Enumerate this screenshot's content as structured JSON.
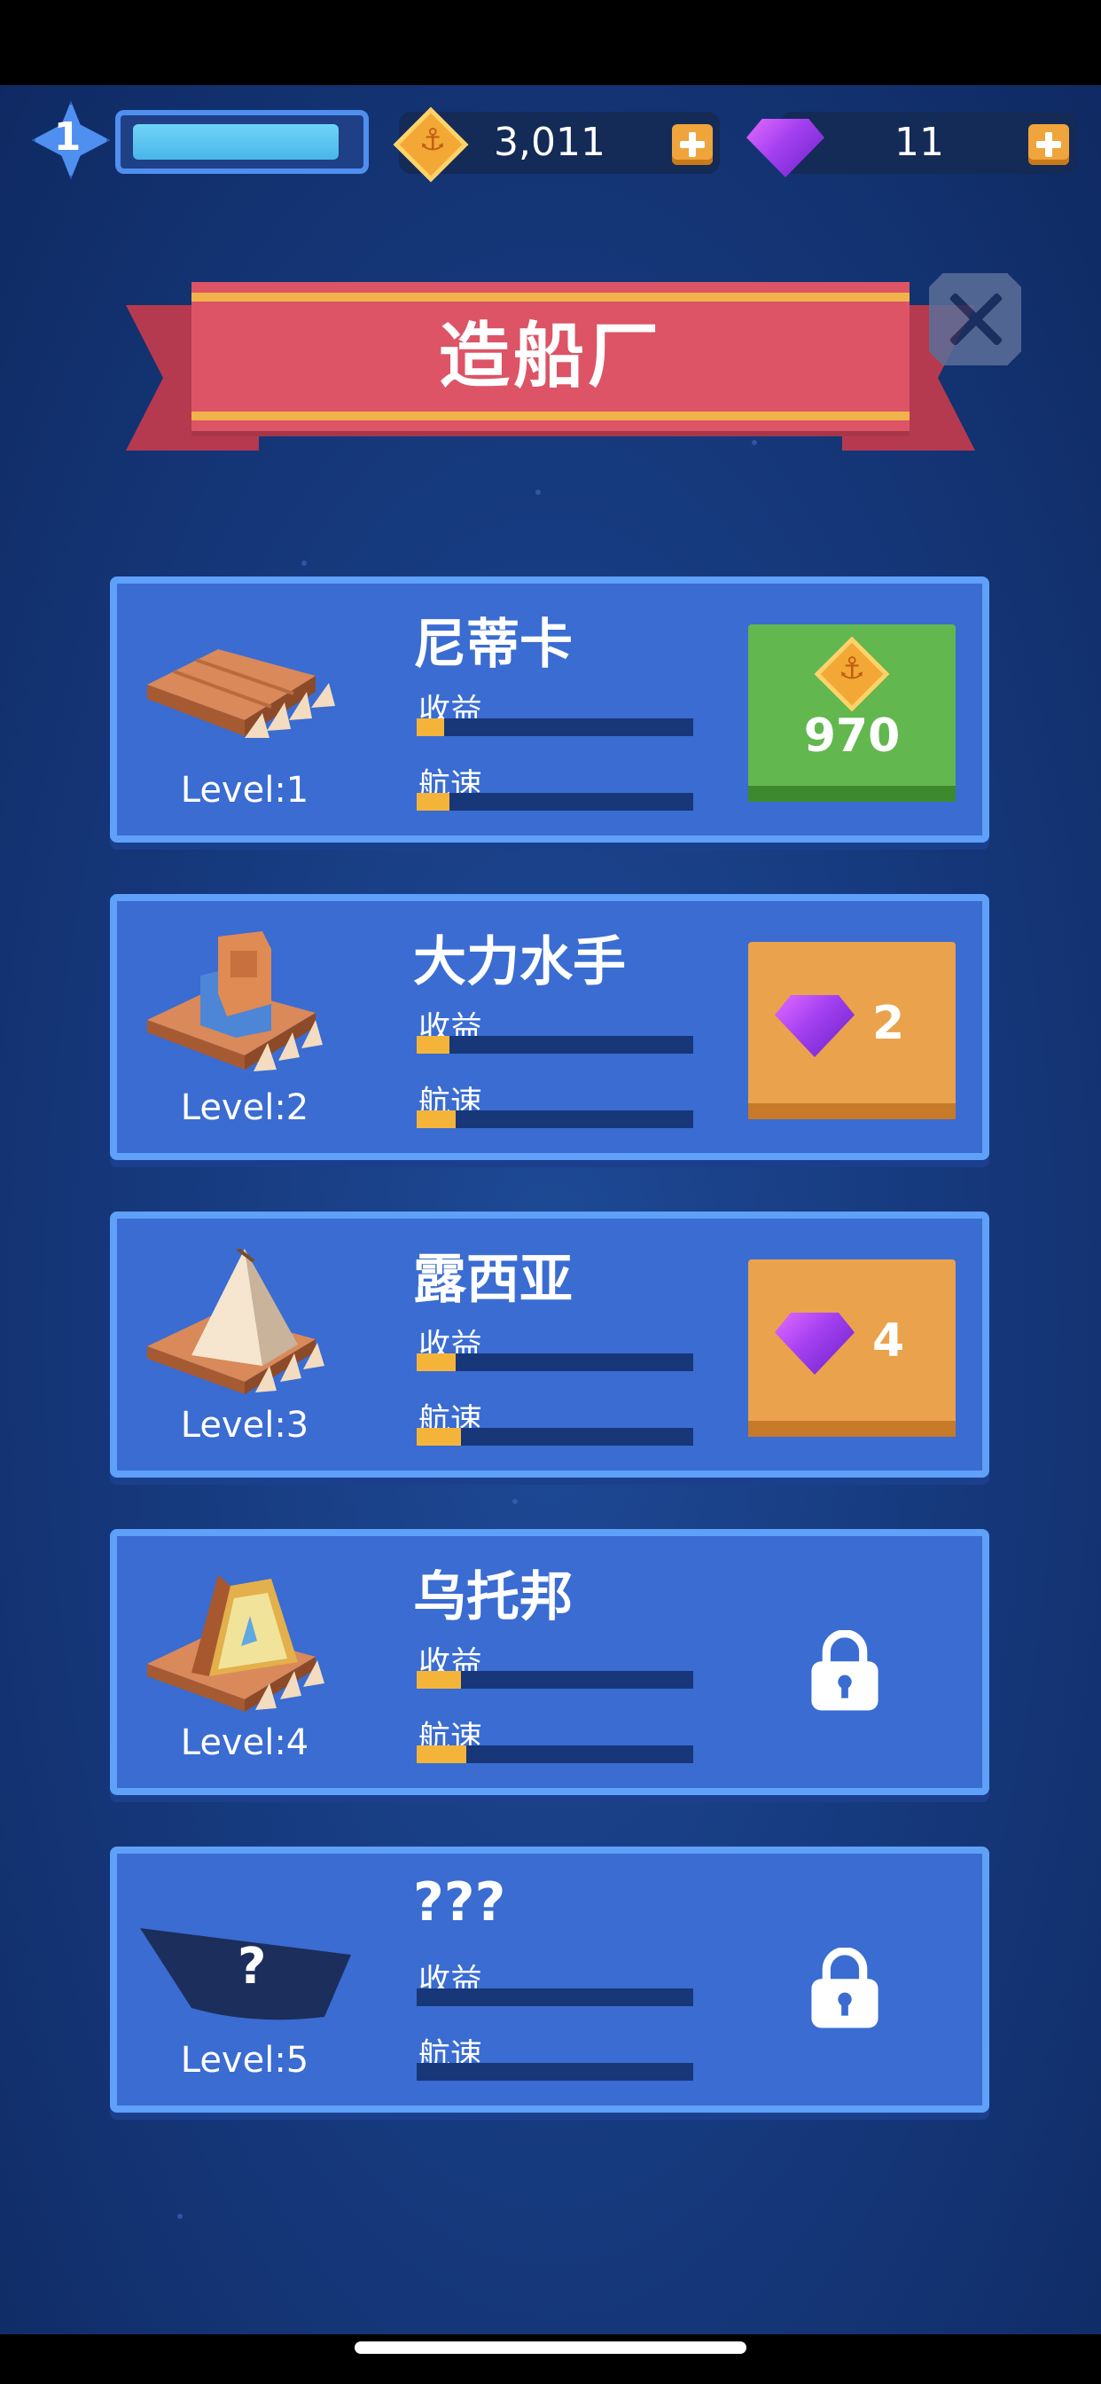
{
  "hud": {
    "player_level": "1",
    "experience_progress": 0.96,
    "coins": "3,011",
    "gems": "11",
    "coin_icon": "anchor-coin-icon",
    "gem_icon": "purple-gem-icon"
  },
  "banner": {
    "title": "造船厂"
  },
  "ships": [
    {
      "name": "尼蒂卡",
      "level": "Level:1",
      "income_label": "收益",
      "speed_label": "航速",
      "income_progress": 0.1,
      "speed_progress": 0.12,
      "status": "buy_coins",
      "price": "970"
    },
    {
      "name": "大力水手",
      "level": "Level:2",
      "income_label": "收益",
      "speed_label": "航速",
      "income_progress": 0.12,
      "speed_progress": 0.14,
      "status": "buy_gems",
      "price": "2"
    },
    {
      "name": "露西亚",
      "level": "Level:3",
      "income_label": "收益",
      "speed_label": "航速",
      "income_progress": 0.14,
      "speed_progress": 0.16,
      "status": "buy_gems",
      "price": "4"
    },
    {
      "name": "乌托邦",
      "level": "Level:4",
      "income_label": "收益",
      "speed_label": "航速",
      "income_progress": 0.16,
      "speed_progress": 0.18,
      "status": "locked"
    },
    {
      "name": "???",
      "level": "Level:5",
      "income_label": "收益",
      "speed_label": "航速",
      "income_progress": 0,
      "speed_progress": 0,
      "status": "locked"
    }
  ],
  "colors": {
    "accent_yellow": "#f4b43a",
    "card_blue": "#3a6cd2",
    "button_green": "#62b74f",
    "button_orange": "#eaa24c",
    "banner_red": "#dc5466"
  }
}
